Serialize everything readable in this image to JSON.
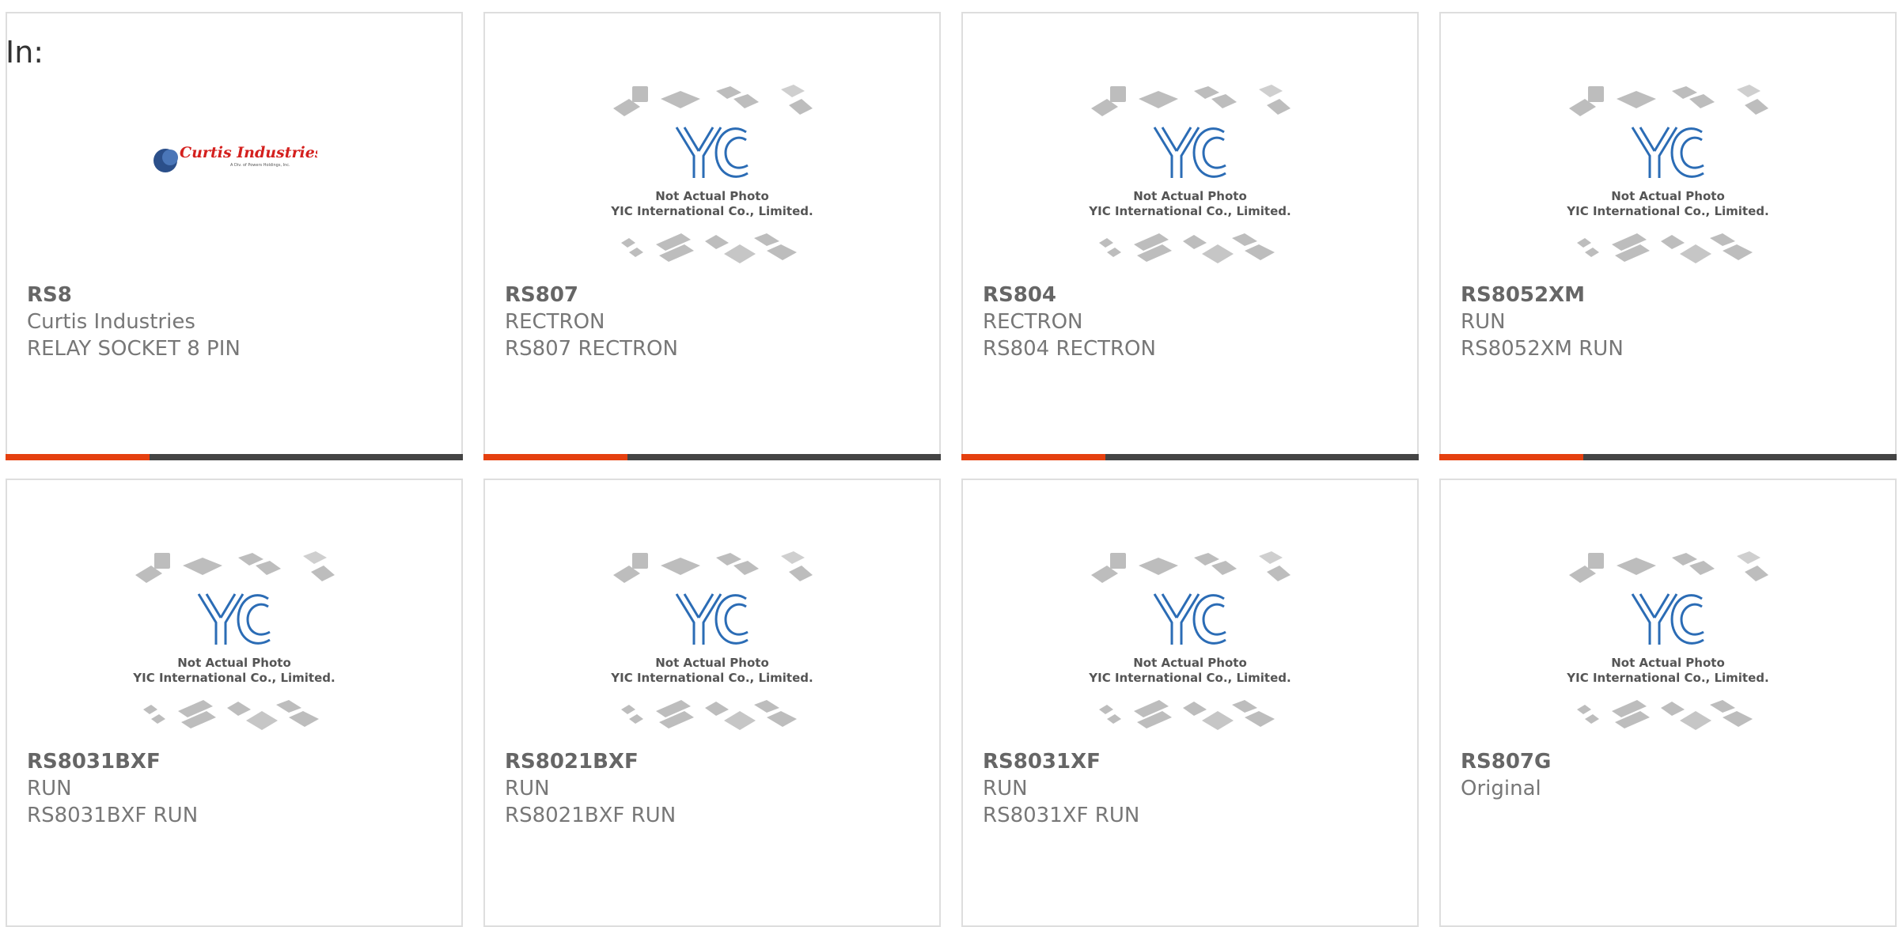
{
  "page": {
    "in_label": "In:"
  },
  "colors": {
    "accent": "#e5400f",
    "bar": "#444444",
    "border": "#dedede",
    "curtis_red": "#d4201e",
    "yic_blue": "#2b6cb5"
  },
  "placeholder_image": {
    "line1": "Not Actual Photo",
    "line2": "YIC International Co., Limited.",
    "logo_text": "YIC"
  },
  "curtis_logo": {
    "name": "Curtis Industries",
    "tagline": "A Div. of Powers Holdings, Inc."
  },
  "products": [
    {
      "part": "RS8",
      "maker": "Curtis Industries",
      "desc": "RELAY SOCKET 8 PIN",
      "image": "curtis-logo"
    },
    {
      "part": "RS807",
      "maker": "RECTRON",
      "desc": "RS807 RECTRON",
      "image": "yic-placeholder"
    },
    {
      "part": "RS804",
      "maker": "RECTRON",
      "desc": "RS804 RECTRON",
      "image": "yic-placeholder"
    },
    {
      "part": "RS8052XM",
      "maker": "RUN",
      "desc": "RS8052XM RUN",
      "image": "yic-placeholder"
    },
    {
      "part": "RS8031BXF",
      "maker": "RUN",
      "desc": "RS8031BXF RUN",
      "image": "yic-placeholder"
    },
    {
      "part": "RS8021BXF",
      "maker": "RUN",
      "desc": "RS8021BXF RUN",
      "image": "yic-placeholder"
    },
    {
      "part": "RS8031XF",
      "maker": "RUN",
      "desc": "RS8031XF RUN",
      "image": "yic-placeholder"
    },
    {
      "part": "RS807G",
      "maker": "Original",
      "desc": "",
      "image": "yic-placeholder"
    }
  ]
}
